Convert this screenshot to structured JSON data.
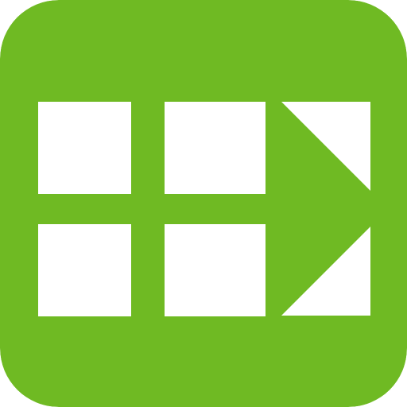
{
  "app_icon": {
    "name": "grid-arrow-app-icon",
    "icon": "grid-arrow-icon",
    "colors": {
      "background": "#6fba23",
      "foreground": "#ffffff"
    }
  }
}
